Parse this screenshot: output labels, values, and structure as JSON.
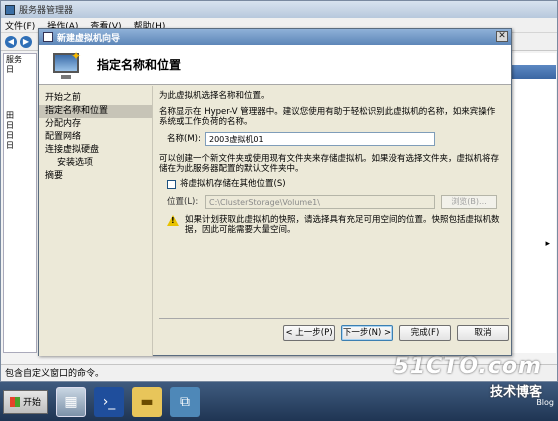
{
  "background_window": {
    "title": "服务器管理器",
    "menu": [
      "文件(F)",
      "操作(A)",
      "查看(V)",
      "帮助(H)"
    ],
    "tree_items": [
      "服务",
      "日",
      "田",
      "日",
      "日",
      "日"
    ],
    "status_text": "包含自定义窗口的命令。"
  },
  "taskbar": {
    "start_label": "开始",
    "icons": [
      "server-manager-icon",
      "powershell-icon",
      "explorer-folder-icon",
      "network-icon"
    ]
  },
  "watermark": {
    "site": "51CTO.com",
    "slogan": "技术博客",
    "blog": "Blog"
  },
  "wizard": {
    "window_title": "新建虚拟机向导",
    "header_title": "指定名称和位置",
    "nav": [
      {
        "label": "开始之前",
        "active": false,
        "sub": false
      },
      {
        "label": "指定名称和位置",
        "active": true,
        "sub": false
      },
      {
        "label": "分配内存",
        "active": false,
        "sub": false
      },
      {
        "label": "配置网络",
        "active": false,
        "sub": false
      },
      {
        "label": "连接虚拟硬盘",
        "active": false,
        "sub": false
      },
      {
        "label": "安装选项",
        "active": false,
        "sub": true
      },
      {
        "label": "摘要",
        "active": false,
        "sub": false
      }
    ],
    "intro": "为此虚拟机选择名称和位置。",
    "name_hint": "名称显示在 Hyper-V 管理器中。建议您使用有助于轻松识别此虚拟机的名称，如来宾操作系统或工作负荷的名称。",
    "name_label": "名称(M):",
    "name_value": "2003虚拟机01",
    "store_hint": "可以创建一个新文件夹或使用现有文件夹来存储虚拟机。如果没有选择文件夹，虚拟机将存储在为此服务器配置的默认文件夹中。",
    "store_checkbox_label": "将虚拟机存储在其他位置(S)",
    "store_checked": false,
    "location_label": "位置(L):",
    "location_value": "C:\\ClusterStorage\\Volume1\\",
    "browse_label": "浏览(B)...",
    "warning": "如果计划获取此虚拟机的快照，请选择具有充足可用空间的位置。快照包括虚拟机数据，因此可能需要大量空间。",
    "buttons": {
      "prev": "< 上一步(P)",
      "next": "下一步(N) >",
      "finish": "完成(F)",
      "cancel": "取消"
    }
  }
}
